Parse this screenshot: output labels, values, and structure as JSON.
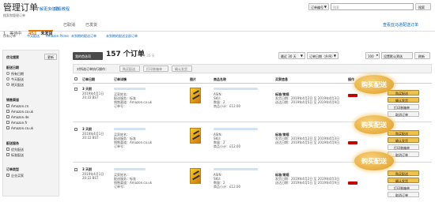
{
  "header": {
    "title": "管理订单",
    "link1": "了解更多信息",
    "link2": "观看教程",
    "subtitle": "搜索和管理订单",
    "search_type": "订单编号",
    "search_placeholder": "搜索",
    "search_button": "搜索",
    "right_link": "查看亚马逊配送订单"
  },
  "tabs": [
    {
      "count": "1",
      "label": "等待中"
    },
    {
      "count": "451",
      "label": "未发货"
    },
    {
      "count": "",
      "label": "已取消"
    },
    {
      "count": "",
      "label": "已发货"
    }
  ],
  "subtabs": [
    "所有订单",
    "今天配送",
    "Amazon Prime",
    "未到期的配送订单",
    "未到期的配送全部订单"
  ],
  "sidebar": {
    "title": "优化搜索",
    "refine_button": "更新",
    "groups": [
      {
        "title": "配送日期",
        "items": [
          "所有日期",
          "今天配送",
          "明天配送"
        ]
      },
      {
        "title": "销售渠道",
        "items": [
          "Amazon.cn",
          "Amazon.co.uk",
          "Amazon.de",
          "Amazon.fr",
          "Amazon.co.uk"
        ]
      },
      {
        "title": "配送服务",
        "items": [
          "优先配送",
          "标准配送"
        ]
      },
      {
        "title": "订单类型",
        "items": [
          "企业买家"
        ]
      }
    ]
  },
  "main": {
    "date_button": "我的首选项",
    "count": "157 个订单",
    "count_note": "共 35 天",
    "filter_range": "最近 30 天",
    "sort": "订单日期（升序）",
    "per_page": "100",
    "refresh_button": "设置默认筛选",
    "refresh_button2": "刷新",
    "action_label": "对所选订单执行操作：",
    "action_buttons": [
      "购买配送",
      "打印装箱单",
      "确认发货"
    ],
    "columns": [
      "订单日期",
      "订单详情",
      "图片",
      "商品名称",
      "买家信息",
      "操作"
    ]
  },
  "orders": [
    {
      "age": "3 天前",
      "date": "2019年4月1日",
      "time": "20:22 BST",
      "fields": [
        "买家姓名：",
        "配送服务：标准",
        "销售渠道：Amazon.co.uk",
        "订单号："
      ],
      "product": [
        "ASIN:",
        "SKU:",
        "数量：2",
        "商品小计：£12.00"
      ],
      "ship_label": "标准/常规",
      "ship_lines": [
        "发货日期：2019年4月2日 至 2019年4月3日",
        "送达日期：2019年4月5日 至 2019年4月9日"
      ],
      "badge": "",
      "actions": [
        "购买配送",
        "确认发货",
        "打印装箱单",
        "取消订单"
      ]
    },
    {
      "age": "3 天前",
      "date": "2019年4月1日",
      "time": "20:22 BST",
      "fields": [
        "买家姓名：",
        "配送服务：标准",
        "销售渠道：Amazon.co.uk",
        "订单号："
      ],
      "product": [
        "ASIN:",
        "SKU:",
        "数量：2",
        "商品小计：£12.00"
      ],
      "ship_label": "标准/常规",
      "ship_lines": [
        "发货日期：2019年4月2日 至 2019年4月3日",
        "送达日期：2019年4月5日 至 2019年4月9日"
      ],
      "badge": "",
      "actions": [
        "购买配送",
        "确认发货",
        "打印装箱单",
        "取消订单"
      ]
    },
    {
      "age": "3 天前",
      "date": "2019年4月1日",
      "time": "20:22 BST",
      "fields": [
        "买家姓名：",
        "配送服务：标准",
        "销售渠道：Amazon.co.uk",
        "订单号："
      ],
      "product": [
        "ASIN:",
        "SKU:",
        "数量：2",
        "商品小计：£12.00"
      ],
      "ship_label": "标准/常规",
      "ship_lines": [
        "发货日期：2019年4月2日 至 2019年4月3日",
        "送达日期：2019年4月5日 至 2019年4月9日"
      ],
      "badge": "",
      "actions": [
        "购买配送",
        "确认发货",
        "打印装箱单",
        "取消订单"
      ]
    }
  ],
  "callouts": [
    "购买配送",
    "购买配送",
    "购买配送"
  ],
  "colors": {
    "accent": "#e47911",
    "button_yellow": "#f0c14b",
    "bubble": "#eab248",
    "link": "#0066c0"
  }
}
